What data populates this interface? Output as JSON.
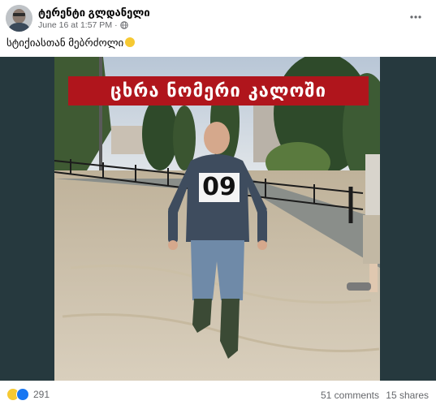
{
  "post": {
    "author": "ტერენტი გლდანელი",
    "timestamp": "June 16 at 1:57 PM",
    "separator": "·",
    "privacy_icon": "globe-icon",
    "more_icon": "more-options-icon",
    "caption": "სტიქიასთან მებრძოლი"
  },
  "photo": {
    "banner_text": "ცხრა ნომერი კალოში",
    "jersey_number": "09"
  },
  "footer": {
    "reaction_icons": [
      "haha-reaction-icon",
      "like-reaction-icon"
    ],
    "reaction_count": "291",
    "comments": "51 comments",
    "shares": "15 shares"
  },
  "colors": {
    "banner": "#b0151c",
    "photo_background": "#26393e",
    "link_gray": "#65676b",
    "like_blue": "#1877f2"
  }
}
